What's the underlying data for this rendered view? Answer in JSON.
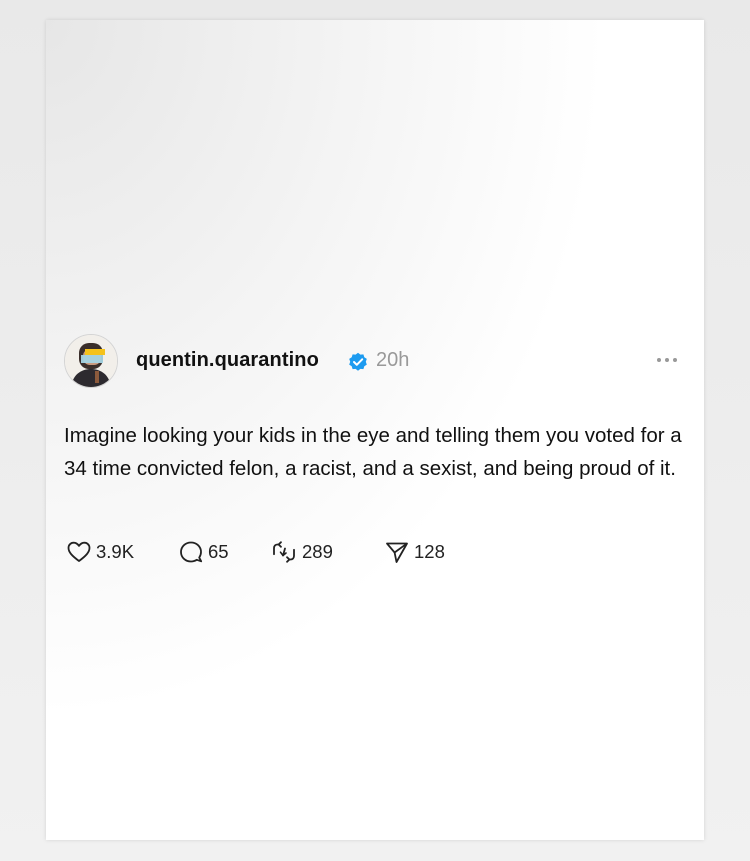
{
  "post": {
    "author": {
      "username": "quentin.quarantino",
      "verified": true,
      "avatar_icon": "profile-photo-avatar",
      "avatar_badge_text": ""
    },
    "timestamp": "20h",
    "more_icon": "more-horizontal-icon",
    "text": "Imagine looking your kids in the eye and telling them you voted for a 34 time convicted felon, a racist, and a sexist, and being proud of it.",
    "stats": {
      "likes": "3.9K",
      "replies": "65",
      "reposts": "289",
      "shares": "128"
    },
    "icons": {
      "like": "heart-icon",
      "reply": "speech-bubble-icon",
      "repost": "repost-icon",
      "share": "paper-plane-icon"
    },
    "colors": {
      "verified_badge": "#1d9bf0",
      "text": "#111111",
      "muted": "#999999"
    }
  }
}
